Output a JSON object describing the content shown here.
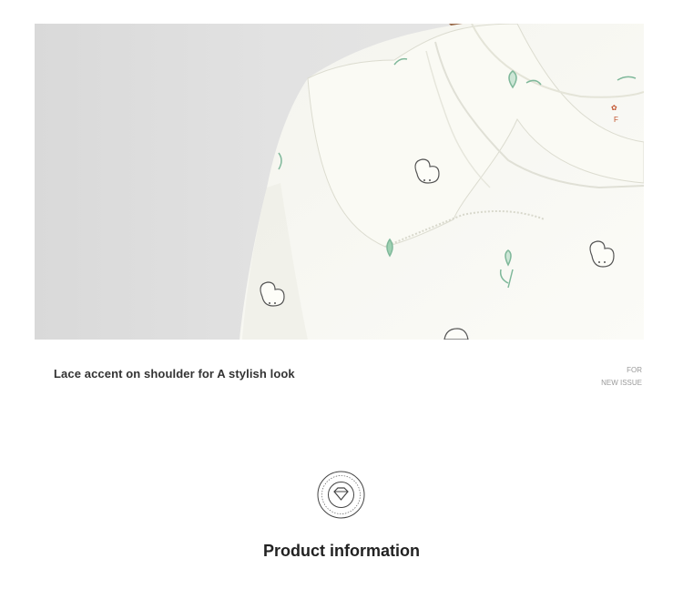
{
  "product_image": {
    "alt": "White ruffled-collar blouse with bunny and tulip print"
  },
  "caption": {
    "text": "Lace accent on shoulder for A stylish look"
  },
  "tag": {
    "line1": "FOR",
    "line2": "NEW ISSUE"
  },
  "section": {
    "title": "Product information"
  },
  "colors": {
    "photo_background": "#e2e2e2",
    "fabric": "#f8f8f2",
    "print_green": "#7fb89a",
    "text_dark": "#333333",
    "text_muted": "#9a9a9a"
  }
}
